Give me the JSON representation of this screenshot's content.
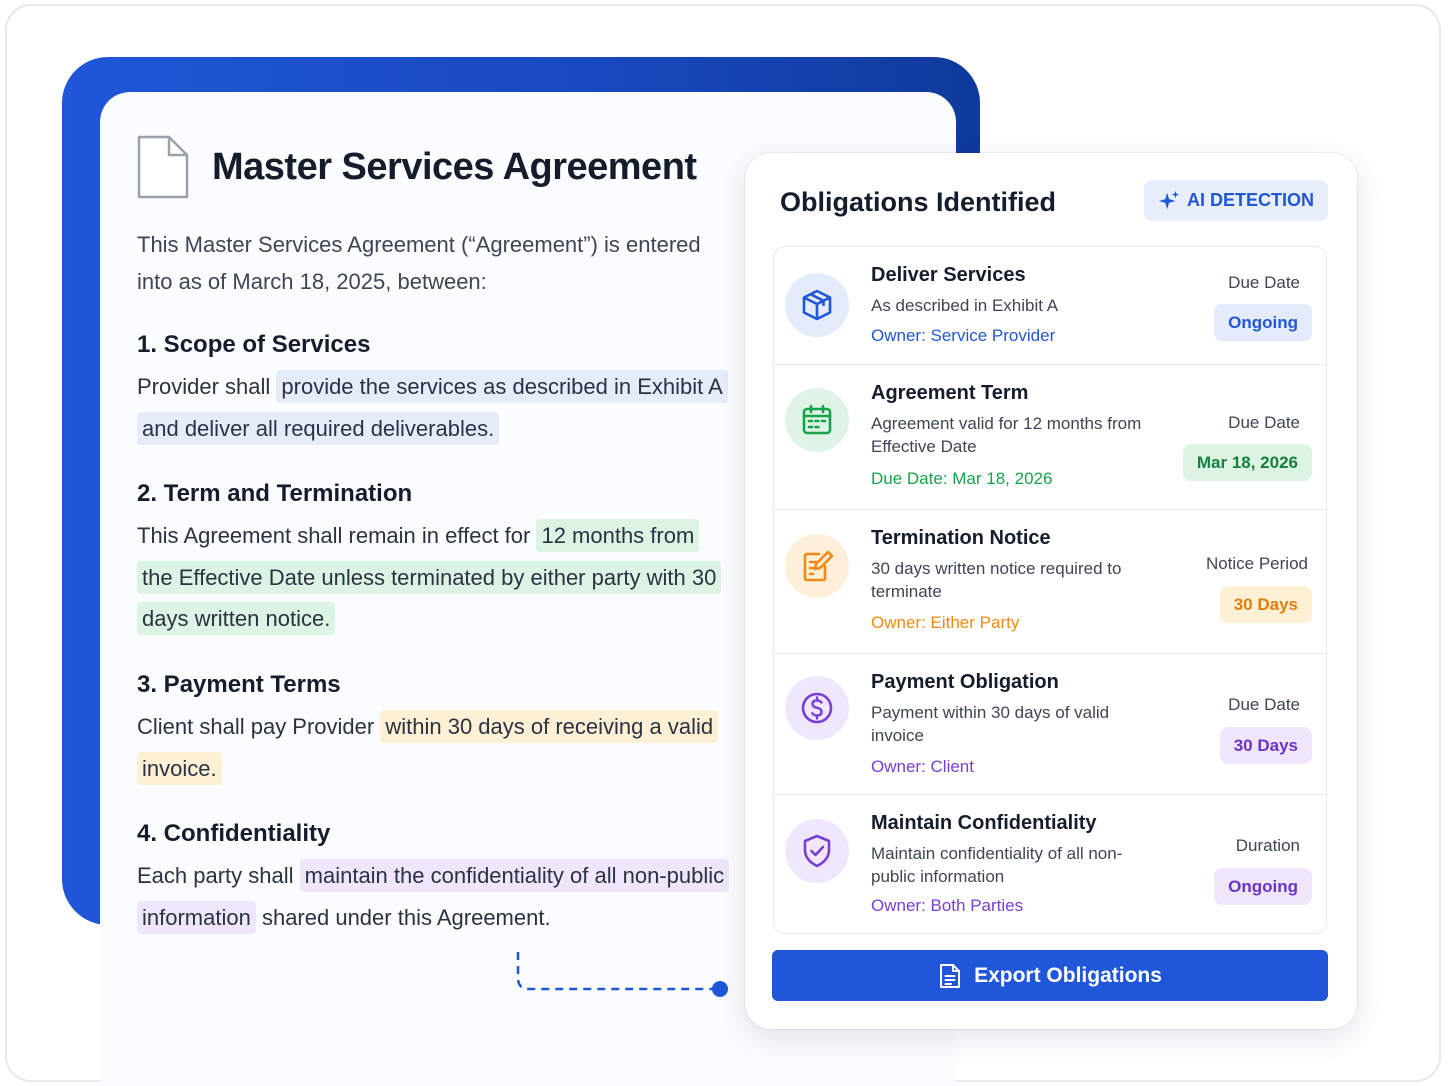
{
  "document": {
    "title": "Master Services Agreement",
    "intro": "This Master Services Agreement (“Agreement”) is entered into as of March 18, 2025, between:",
    "sections": [
      {
        "title": "1. Scope of Services",
        "pre": "Provider shall ",
        "highlight": "provide the services as described in Exhibit A and deliver all required deliverables.",
        "post": "",
        "highlight_color": "#e5edfb"
      },
      {
        "title": "2. Term and Termination",
        "pre": "This Agreement shall remain in effect for ",
        "highlight": "12 months from the Effective Date unless terminated by either party with 30 days written notice.",
        "post": "",
        "highlight_color": "#dcf4e4"
      },
      {
        "title": "3. Payment Terms",
        "pre": "Client shall pay Provider ",
        "highlight": "within 30 days of receiving a valid invoice.",
        "post": "",
        "highlight_color": "#fdf0d4"
      },
      {
        "title": "4. Confidentiality",
        "pre": "Each party shall ",
        "highlight": "maintain the confidentiality of all non-public information",
        "post": " shared under this Agreement.",
        "highlight_color": "#efe6fb"
      }
    ]
  },
  "panel": {
    "title": "Obligations Identified",
    "ai_badge": "AI DETECTION",
    "export_label": "Export Obligations",
    "obligations": [
      {
        "icon": "box-icon",
        "title": "Deliver Services",
        "description": "As described in Exhibit A",
        "owner": "Owner: Service Provider",
        "label": "Due Date",
        "pill": "Ongoing",
        "accent": "#1f57d8",
        "pill_bg": "#e4ecfb",
        "circle_bg": "#e4ecfb"
      },
      {
        "icon": "calendar-icon",
        "title": "Agreement Term",
        "description": "Agreement valid for 12 months from Effective Date",
        "owner": "Due Date: Mar 18, 2026",
        "label": "Due Date",
        "pill": "Mar 18, 2026",
        "accent": "#17a34a",
        "pill_bg": "#dcf4e4",
        "circle_bg": "#dff4e7"
      },
      {
        "icon": "edit-document-icon",
        "title": "Termination Notice",
        "description": "30 days written notice required to terminate",
        "owner": "Owner: Either Party",
        "label": "Notice Period",
        "pill": "30 Days",
        "accent": "#f08a12",
        "pill_bg": "#fdf0d4",
        "circle_bg": "#fdefd8"
      },
      {
        "icon": "dollar-icon",
        "title": "Payment Obligation",
        "description": "Payment within 30 days of valid invoice",
        "owner": "Owner: Client",
        "label": "Due Date",
        "pill": "30 Days",
        "accent": "#7a3ed8",
        "pill_bg": "#efe6fb",
        "circle_bg": "#efe7fb"
      },
      {
        "icon": "shield-check-icon",
        "title": "Maintain Confidentiality",
        "description": "Maintain confidentiality of all non-public information",
        "owner": "Owner: Both Parties",
        "label": "Duration",
        "pill": "Ongoing",
        "accent": "#7a3ed8",
        "pill_bg": "#efe6fb",
        "circle_bg": "#efe7fb"
      }
    ]
  }
}
